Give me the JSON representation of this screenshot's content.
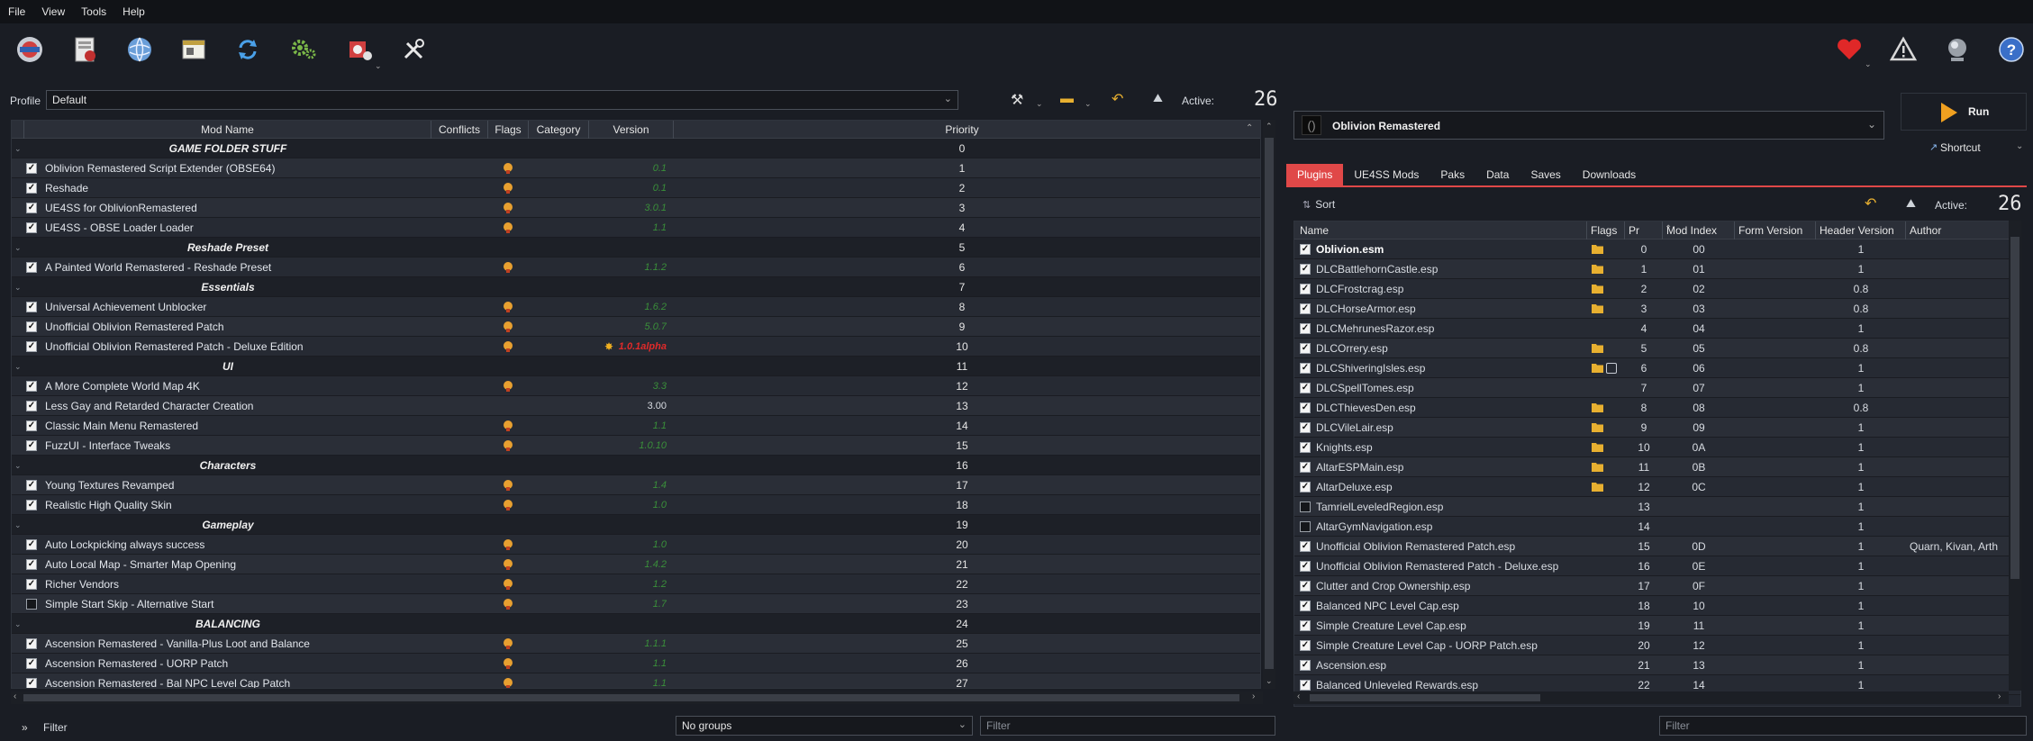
{
  "menu": [
    "File",
    "View",
    "Tools",
    "Help"
  ],
  "toolbar": {
    "left_icons": [
      "instances-icon",
      "archives-icon",
      "nexus-icon",
      "executables-icon",
      "refresh-icon",
      "settings-icon",
      "plugins-tools-icon",
      "tools-icon"
    ],
    "right_icons": [
      "endorse-heart-icon",
      "warning-icon",
      "update-globe-icon",
      "help-icon"
    ]
  },
  "profile": {
    "label": "Profile",
    "value": "Default"
  },
  "active_label": "Active:",
  "active_count": "26",
  "mod_table": {
    "headers": [
      "Mod Name",
      "Conflicts",
      "Flags",
      "Category",
      "Version",
      "Priority"
    ],
    "rows": [
      {
        "type": "sep",
        "name": "GAME FOLDER STUFF",
        "priority": "0"
      },
      {
        "type": "mod",
        "checked": true,
        "name": "Oblivion Remastered Script Extender (OBSE64)",
        "flag": true,
        "version": "0.1",
        "priority": "1"
      },
      {
        "type": "mod",
        "checked": true,
        "name": "Reshade",
        "flag": true,
        "version": "0.1",
        "priority": "2"
      },
      {
        "type": "mod",
        "checked": true,
        "name": "UE4SS for OblivionRemastered",
        "flag": true,
        "version": "3.0.1",
        "priority": "3"
      },
      {
        "type": "mod",
        "checked": true,
        "name": "UE4SS - OBSE Loader Loader",
        "flag": true,
        "version": "1.1",
        "priority": "4"
      },
      {
        "type": "sep",
        "name": "Reshade Preset",
        "priority": "5"
      },
      {
        "type": "mod",
        "checked": true,
        "name": "A Painted World Remastered - Reshade Preset",
        "flag": true,
        "version": "1.1.2",
        "priority": "6"
      },
      {
        "type": "sep",
        "name": "Essentials",
        "priority": "7"
      },
      {
        "type": "mod",
        "checked": true,
        "name": "Universal Achievement Unblocker",
        "flag": true,
        "version": "1.6.2",
        "priority": "8"
      },
      {
        "type": "mod",
        "checked": true,
        "name": "Unofficial Oblivion Remastered Patch",
        "flag": true,
        "version": "5.0.7",
        "priority": "9"
      },
      {
        "type": "mod",
        "checked": true,
        "name": "Unofficial Oblivion Remastered Patch - Deluxe Edition",
        "flag": true,
        "version": "1.0.1alpha",
        "vstyle": "red",
        "burst": true,
        "priority": "10"
      },
      {
        "type": "sep",
        "name": "UI",
        "priority": "11"
      },
      {
        "type": "mod",
        "checked": true,
        "name": "A More Complete World Map 4K",
        "flag": true,
        "version": "3.3",
        "priority": "12"
      },
      {
        "type": "mod",
        "checked": true,
        "name": "Less Gay and Retarded Character Creation",
        "flag": false,
        "version": "3.00",
        "vstyle": "plain",
        "priority": "13"
      },
      {
        "type": "mod",
        "checked": true,
        "name": "Classic Main Menu Remastered",
        "flag": true,
        "version": "1.1",
        "priority": "14"
      },
      {
        "type": "mod",
        "checked": true,
        "name": "FuzzUI - Interface Tweaks",
        "flag": true,
        "version": "1.0.10",
        "priority": "15"
      },
      {
        "type": "sep",
        "name": "Characters",
        "priority": "16"
      },
      {
        "type": "mod",
        "checked": true,
        "name": "Young Textures Revamped",
        "flag": true,
        "version": "1.4",
        "priority": "17"
      },
      {
        "type": "mod",
        "checked": true,
        "name": "Realistic High Quality Skin",
        "flag": true,
        "version": "1.0",
        "priority": "18"
      },
      {
        "type": "sep",
        "name": "Gameplay",
        "priority": "19"
      },
      {
        "type": "mod",
        "checked": true,
        "name": "Auto Lockpicking always success",
        "flag": true,
        "version": "1.0",
        "priority": "20"
      },
      {
        "type": "mod",
        "checked": true,
        "name": "Auto Local Map - Smarter Map Opening",
        "flag": true,
        "version": "1.4.2",
        "priority": "21"
      },
      {
        "type": "mod",
        "checked": true,
        "name": "Richer Vendors",
        "flag": true,
        "version": "1.2",
        "priority": "22"
      },
      {
        "type": "mod",
        "checked": false,
        "name": "Simple Start Skip - Alternative Start",
        "flag": true,
        "version": "1.7",
        "priority": "23"
      },
      {
        "type": "sep",
        "name": "BALANCING",
        "priority": "24"
      },
      {
        "type": "mod",
        "checked": true,
        "name": "Ascension Remastered - Vanilla-Plus Loot and Balance",
        "flag": true,
        "version": "1.1.1",
        "priority": "25"
      },
      {
        "type": "mod",
        "checked": true,
        "name": "Ascension Remastered - UORP Patch",
        "flag": true,
        "version": "1.1",
        "priority": "26"
      },
      {
        "type": "mod",
        "checked": true,
        "name": "Ascension Remastered - Bal NPC Level Cap Patch",
        "flag": true,
        "version": "1.1",
        "priority": "27"
      }
    ]
  },
  "bottom": {
    "filter_toggle": "»",
    "filter_label": "Filter",
    "groups_value": "No groups",
    "filter_placeholder": "Filter",
    "plugin_filter_placeholder": "Filter"
  },
  "right": {
    "executable": "Oblivion Remastered",
    "run_label": "Run",
    "shortcut_label": "Shortcut",
    "tabs": [
      "Plugins",
      "UE4SS Mods",
      "Paks",
      "Data",
      "Saves",
      "Downloads"
    ],
    "sort_label": "Sort",
    "active_label": "Active:",
    "active_count": "26"
  },
  "plugin_table": {
    "headers": [
      "Name",
      "Flags",
      "Pr",
      "Mod Index",
      "Form Version",
      "Header Version",
      "Author"
    ],
    "rows": [
      {
        "checked": true,
        "name": "Oblivion.esm",
        "bold": true,
        "folder": true,
        "pr": "0",
        "idx": "00",
        "form": "",
        "header": "1",
        "author": ""
      },
      {
        "checked": true,
        "name": "DLCBattlehornCastle.esp",
        "folder": true,
        "pr": "1",
        "idx": "01",
        "form": "",
        "header": "1",
        "author": ""
      },
      {
        "checked": true,
        "name": "DLCFrostcrag.esp",
        "folder": true,
        "pr": "2",
        "idx": "02",
        "form": "",
        "header": "0.8",
        "author": ""
      },
      {
        "checked": true,
        "name": "DLCHorseArmor.esp",
        "folder": true,
        "pr": "3",
        "idx": "03",
        "form": "",
        "header": "0.8",
        "author": ""
      },
      {
        "checked": true,
        "name": "DLCMehrunesRazor.esp",
        "folder": false,
        "pr": "4",
        "idx": "04",
        "form": "",
        "header": "1",
        "author": ""
      },
      {
        "checked": true,
        "name": "DLCOrrery.esp",
        "folder": true,
        "pr": "5",
        "idx": "05",
        "form": "",
        "header": "0.8",
        "author": ""
      },
      {
        "checked": true,
        "name": "DLCShiveringIsles.esp",
        "folder": true,
        "box": true,
        "pr": "6",
        "idx": "06",
        "form": "",
        "header": "1",
        "author": ""
      },
      {
        "checked": true,
        "name": "DLCSpellTomes.esp",
        "folder": false,
        "pr": "7",
        "idx": "07",
        "form": "",
        "header": "1",
        "author": ""
      },
      {
        "checked": true,
        "name": "DLCThievesDen.esp",
        "folder": true,
        "pr": "8",
        "idx": "08",
        "form": "",
        "header": "0.8",
        "author": ""
      },
      {
        "checked": true,
        "name": "DLCVileLair.esp",
        "folder": true,
        "pr": "9",
        "idx": "09",
        "form": "",
        "header": "1",
        "author": ""
      },
      {
        "checked": true,
        "name": "Knights.esp",
        "folder": true,
        "pr": "10",
        "idx": "0A",
        "form": "",
        "header": "1",
        "author": ""
      },
      {
        "checked": true,
        "name": "AltarESPMain.esp",
        "folder": true,
        "pr": "11",
        "idx": "0B",
        "form": "",
        "header": "1",
        "author": ""
      },
      {
        "checked": true,
        "name": "AltarDeluxe.esp",
        "folder": true,
        "pr": "12",
        "idx": "0C",
        "form": "",
        "header": "1",
        "author": ""
      },
      {
        "checked": false,
        "name": "TamrielLeveledRegion.esp",
        "folder": false,
        "pr": "13",
        "idx": "",
        "form": "",
        "header": "1",
        "author": ""
      },
      {
        "checked": false,
        "name": "AltarGymNavigation.esp",
        "folder": false,
        "pr": "14",
        "idx": "",
        "form": "",
        "header": "1",
        "author": ""
      },
      {
        "checked": true,
        "name": "Unofficial Oblivion Remastered Patch.esp",
        "folder": false,
        "pr": "15",
        "idx": "0D",
        "form": "",
        "header": "1",
        "author": "Quarn, Kivan, Arth"
      },
      {
        "checked": true,
        "name": "Unofficial Oblivion Remastered Patch - Deluxe.esp",
        "folder": false,
        "pr": "16",
        "idx": "0E",
        "form": "",
        "header": "1",
        "author": ""
      },
      {
        "checked": true,
        "name": "Clutter and Crop Ownership.esp",
        "folder": false,
        "pr": "17",
        "idx": "0F",
        "form": "",
        "header": "1",
        "author": ""
      },
      {
        "checked": true,
        "name": "Balanced NPC Level Cap.esp",
        "folder": false,
        "pr": "18",
        "idx": "10",
        "form": "",
        "header": "1",
        "author": ""
      },
      {
        "checked": true,
        "name": "Simple Creature Level Cap.esp",
        "folder": false,
        "pr": "19",
        "idx": "11",
        "form": "",
        "header": "1",
        "author": ""
      },
      {
        "checked": true,
        "name": "Simple Creature Level Cap - UORP Patch.esp",
        "folder": false,
        "pr": "20",
        "idx": "12",
        "form": "",
        "header": "1",
        "author": ""
      },
      {
        "checked": true,
        "name": "Ascension.esp",
        "folder": false,
        "pr": "21",
        "idx": "13",
        "form": "",
        "header": "1",
        "author": ""
      },
      {
        "checked": true,
        "name": "Balanced Unleveled Rewards.esp",
        "folder": false,
        "pr": "22",
        "idx": "14",
        "form": "",
        "header": "1",
        "author": ""
      }
    ]
  },
  "colors": {
    "accent_tab": "#e04848",
    "version_green": "#3a8f3a",
    "version_red": "#e02a2a",
    "flag_orange": "#e8a030",
    "folder_yellow": "#e8b030"
  }
}
